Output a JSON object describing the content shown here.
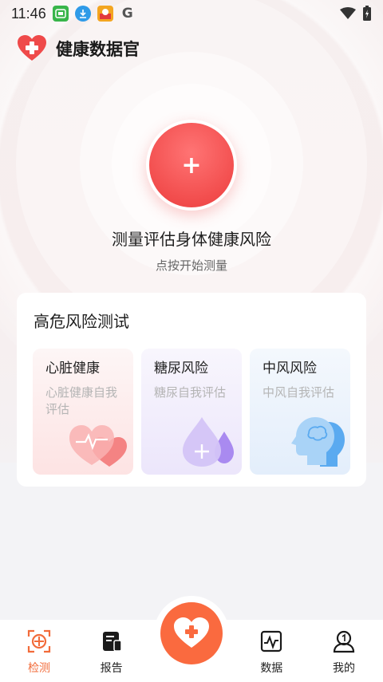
{
  "status_bar": {
    "time": "11:46",
    "notification_icons": [
      "app-icon",
      "download-icon",
      "shopping-icon",
      "google-icon"
    ],
    "right_icons": [
      "wifi-icon",
      "battery-icon"
    ]
  },
  "header": {
    "title": "健康数据官",
    "logo_icon": "heart-plus-logo"
  },
  "hero": {
    "button_symbol": "+",
    "title": "测量评估身体健康风险",
    "subtitle": "点按开始测量"
  },
  "risk_section": {
    "title": "高危风险测试",
    "items": [
      {
        "name": "心脏健康",
        "desc": "心脏健康自我评估",
        "icon": "heart-pulse-icon",
        "color": "#f58a8a"
      },
      {
        "name": "糖尿风险",
        "desc": "糖尿自我评估",
        "icon": "blood-drop-icon",
        "color": "#a98af0"
      },
      {
        "name": "中风风险",
        "desc": "中风自我评估",
        "icon": "head-brain-icon",
        "color": "#6eb4ef"
      }
    ]
  },
  "bottom_nav": {
    "items": [
      {
        "label": "检测",
        "icon": "detect-icon",
        "active": true
      },
      {
        "label": "报告",
        "icon": "report-icon",
        "active": false
      },
      {
        "label": "数据",
        "icon": "data-chart-icon",
        "active": false
      },
      {
        "label": "我的",
        "icon": "profile-icon",
        "active": false
      }
    ],
    "center_icon": "heart-plus-icon"
  },
  "colors": {
    "accent": "#f26b3a",
    "fab": "#fa6a3f",
    "hero_red": "#f24d4d"
  }
}
